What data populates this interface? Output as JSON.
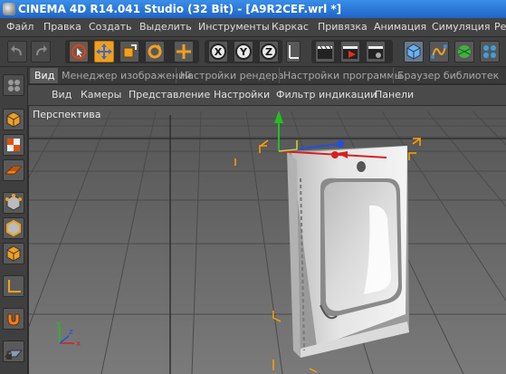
{
  "window": {
    "title": "CINEMA 4D R14.041 Studio (32 Bit) - [A9R2CEF.wrl *]"
  },
  "menu": {
    "items": [
      "Файл",
      "Правка",
      "Создать",
      "Выделить",
      "Инструменты",
      "Каркас",
      "Привязка",
      "Анимация",
      "Симуляция",
      "Ре"
    ]
  },
  "toolbar": {
    "axis_x": "X",
    "axis_y": "Y",
    "axis_z": "Z"
  },
  "tabs": [
    "Вид",
    "Менеджер изображений",
    "Настройки рендера",
    "Настройки программы",
    "Браузер библиотек"
  ],
  "viewport_menu": [
    "Вид",
    "Камеры",
    "Представление",
    "Настройки",
    "Фильтр индикации",
    "Панели"
  ],
  "viewport": {
    "label": "Перспектива",
    "axis_labels": {
      "x": "x",
      "y": "y",
      "z": "z"
    }
  },
  "colors": {
    "x_axis": "#d82020",
    "y_axis": "#22c020",
    "z_axis": "#2050e0",
    "bbox": "#ffa000",
    "active_tool": "#f0a020"
  }
}
